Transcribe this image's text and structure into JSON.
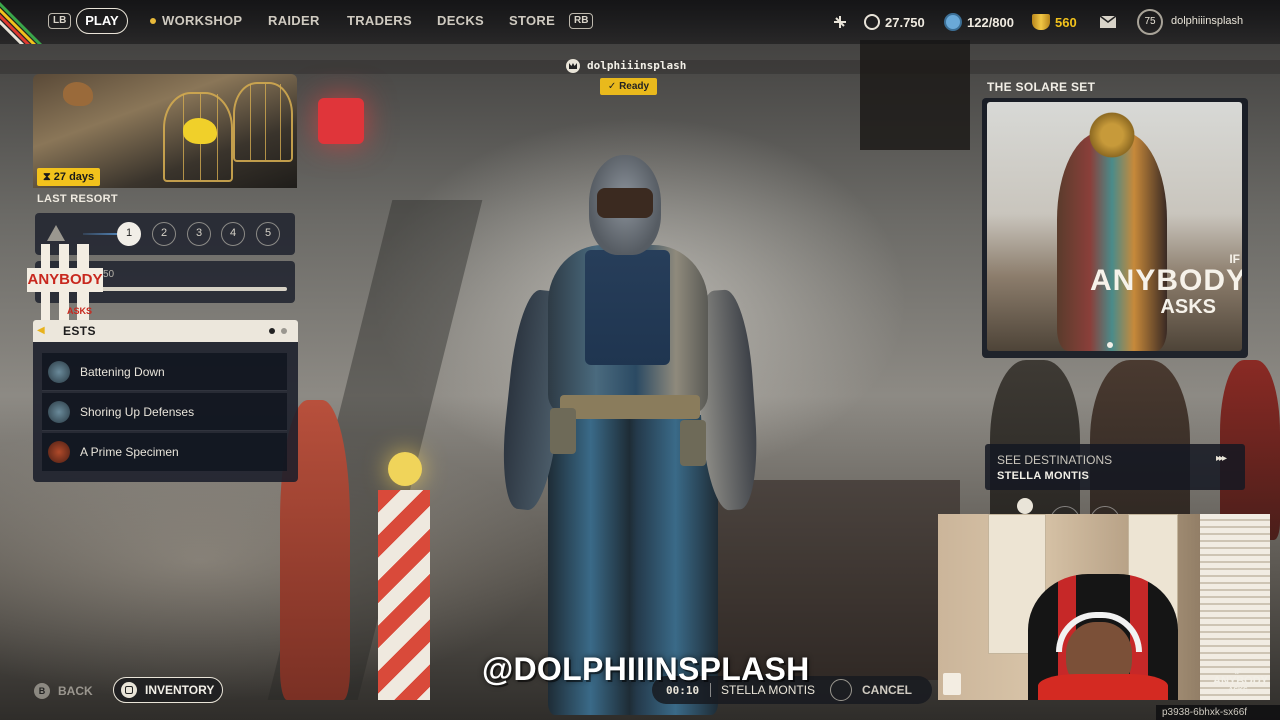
{
  "nav": {
    "lb": "LB",
    "rb": "RB",
    "play": "PLAY",
    "items": [
      "WORKSHOP",
      "RAIDER",
      "TRADERS",
      "DECKS",
      "STORE"
    ]
  },
  "currency": {
    "coins": "27.750",
    "storage": "122/800",
    "tokens": "560"
  },
  "profile": {
    "level": "75",
    "username": "dolphiiinsplash"
  },
  "event": {
    "timer": "27 days",
    "title": "LAST RESORT",
    "steps": [
      "1",
      "2",
      "3",
      "4",
      "5"
    ],
    "active_step": "1",
    "progress_text": "50",
    "logo_word": "ANYBODY",
    "logo_sub": "ASKS"
  },
  "quests": {
    "header": "ESTS",
    "items": [
      {
        "name": "Battening Down"
      },
      {
        "name": "Shoring Up Defenses"
      },
      {
        "name": "A Prime Specimen"
      }
    ]
  },
  "lobby": {
    "player_name": "dolphiiinsplash",
    "status": "Ready"
  },
  "featured": {
    "title": "THE SOLARE SET",
    "logo_l1": "IF",
    "logo_l2": "ANYBODY",
    "logo_l3": "ASKS"
  },
  "destinations": {
    "label": "SEE DESTINATIONS",
    "name": "STELLA MONTIS",
    "arrow": "▸▸▸"
  },
  "bottom": {
    "back_icon": "B",
    "back": "BACK",
    "inventory": "INVENTORY",
    "match_time": "00:10",
    "match_map": "STELLA MONTIS",
    "cancel": "CANCEL"
  },
  "stream": {
    "handle": "@DOLPHIIINSPLASH",
    "cam_logo_l1": "IF",
    "cam_logo_l2": "ANYBODY",
    "cam_logo_l3": "ASKS",
    "session_id": "p3938-6bhxk-sx66f"
  },
  "colors": {
    "accent_yellow": "#f2c21c",
    "panel_bg": "#1a1e2a",
    "text_primary": "#e9e4d8",
    "storage_blue": "#6aa9d8",
    "token_gold": "#f1c745",
    "brand_red": "#c8281e"
  }
}
